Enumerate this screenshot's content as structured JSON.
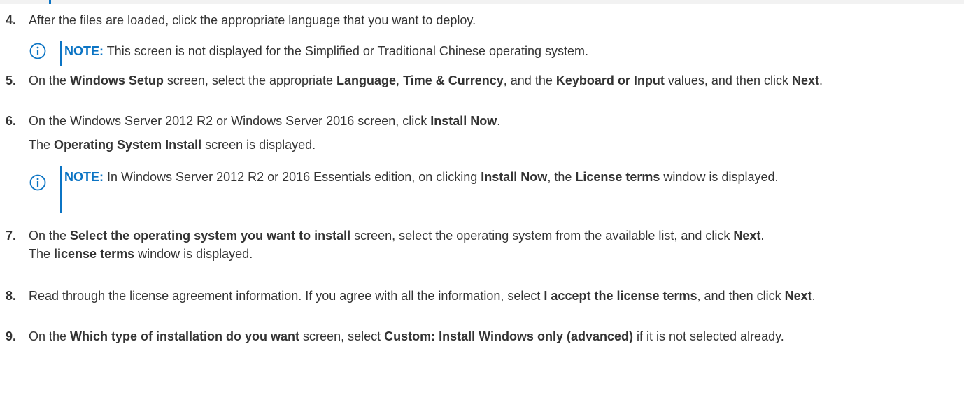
{
  "steps": [
    {
      "num": "4.",
      "text": "After the files are loaded, click the appropriate language that you want to deploy.",
      "note": "This screen is not displayed for the Simplified or Traditional Chinese operating system."
    },
    {
      "num": "5.",
      "t1": "On the ",
      "b1": "Windows Setup",
      "t2": " screen, select the appropriate ",
      "b2": "Language",
      "t3": ", ",
      "b3": "Time & Currency",
      "t4": ", and the ",
      "b4": "Keyboard or Input",
      "t5": " values, and then click ",
      "b5": "Next",
      "t6": "."
    },
    {
      "num": "6.",
      "t1": "On the Windows Server 2012 R2 or Windows Server 2016 screen, click ",
      "b1": "Install Now",
      "t2": ".",
      "sub_t1": "The ",
      "sub_b1": "Operating System Install",
      "sub_t2": " screen is displayed.",
      "note_t1": "In Windows Server 2012 R2 or 2016 Essentials edition, on clicking ",
      "note_b1": "Install Now",
      "note_t2": ", the ",
      "note_b2": "License terms",
      "note_t3": " window is displayed."
    },
    {
      "num": "7.",
      "t1": "On the ",
      "b1": "Select the operating system you want to install",
      "t2": " screen, select the operating system from the available list, and click ",
      "b2": "Next",
      "t3": ".",
      "sub_t1": "The ",
      "sub_b1": "license terms",
      "sub_t2": " window is displayed."
    },
    {
      "num": "8.",
      "t1": "Read through the license agreement information. If you agree with all the information, select ",
      "b1": "I accept the license terms",
      "t2": ", and then click ",
      "b2": "Next",
      "t3": "."
    },
    {
      "num": "9.",
      "t1": "On the ",
      "b1": "Which type of installation do you want",
      "t2": " screen, select ",
      "b2": "Custom: Install Windows only (advanced)",
      "t3": " if it is not selected already."
    }
  ],
  "note_label": "NOTE:",
  "colors": {
    "accent": "#0b74c4",
    "text": "#333333"
  },
  "icons": {
    "note": "info-circle-icon"
  }
}
